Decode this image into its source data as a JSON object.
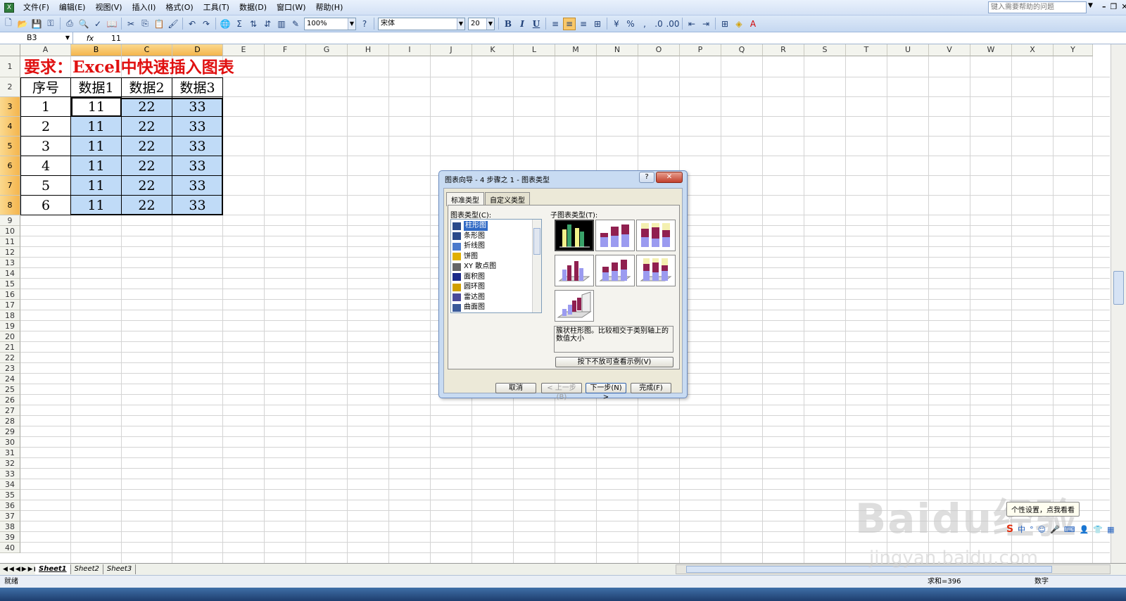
{
  "menu": {
    "items": [
      "文件(F)",
      "编辑(E)",
      "视图(V)",
      "插入(I)",
      "格式(O)",
      "工具(T)",
      "数据(D)",
      "窗口(W)",
      "帮助(H)"
    ],
    "help_placeholder": "键入需要帮助的问题"
  },
  "toolbar": {
    "zoom": "100%",
    "font": "宋体",
    "size": "20",
    "bold": "B",
    "italic": "I",
    "underline": "U"
  },
  "formula_bar": {
    "name_box": "B3",
    "fx": "fx",
    "value": "11"
  },
  "sheet": {
    "columns": [
      "A",
      "B",
      "C",
      "D",
      "E",
      "F",
      "G",
      "H",
      "I",
      "J",
      "K",
      "L",
      "M",
      "N",
      "O",
      "P",
      "Q",
      "R",
      "S",
      "T",
      "U",
      "V",
      "W",
      "X",
      "Y"
    ],
    "selected_columns": [
      "B",
      "C",
      "D"
    ],
    "rows": [
      "1",
      "2",
      "3",
      "4",
      "5",
      "6",
      "7",
      "8",
      "9",
      "10",
      "11",
      "12",
      "13",
      "14",
      "15",
      "16",
      "17",
      "18",
      "19",
      "20",
      "21",
      "22",
      "23",
      "24",
      "25",
      "26",
      "27",
      "28",
      "29",
      "30",
      "31",
      "32",
      "33",
      "34",
      "35",
      "36",
      "37",
      "38",
      "39",
      "40"
    ],
    "selected_rows": [
      "3",
      "4",
      "5",
      "6",
      "7",
      "8"
    ],
    "title": "要求：Excel中快速插入图表",
    "headers": [
      "序号",
      "数据1",
      "数据2",
      "数据3"
    ],
    "data": [
      [
        "1",
        "11",
        "22",
        "33"
      ],
      [
        "2",
        "11",
        "22",
        "33"
      ],
      [
        "3",
        "11",
        "22",
        "33"
      ],
      [
        "4",
        "11",
        "22",
        "33"
      ],
      [
        "5",
        "11",
        "22",
        "33"
      ],
      [
        "6",
        "11",
        "22",
        "33"
      ]
    ]
  },
  "sheet_tabs": [
    "Sheet1",
    "Sheet2",
    "Sheet3"
  ],
  "status": {
    "ready": "就绪",
    "sum": "求和=396",
    "mode": "数字"
  },
  "dialog": {
    "title": "图表向导 - 4 步骤之 1 - 图表类型",
    "help": "?",
    "close": "✕",
    "tabs": [
      "标准类型",
      "自定义类型"
    ],
    "chart_type_label": "图表类型(C):",
    "sub_type_label": "子图表类型(T):",
    "chart_types": [
      "柱形图",
      "条形图",
      "折线图",
      "饼图",
      "XY 散点图",
      "面积图",
      "圆环图",
      "雷达图",
      "曲面图"
    ],
    "description": "簇状柱形图。比较相交于类别轴上的数值大小",
    "press_button": "按下不放可查看示例(V)",
    "buttons": {
      "cancel": "取消",
      "back": "< 上一步(B)",
      "next": "下一步(N) >",
      "finish": "完成(F)"
    }
  },
  "overlay": {
    "tooltip": "个性设置，点我看看",
    "watermark": "Baidu经验",
    "watermark_url": "jingyan.baidu.com",
    "ime_lang": "中"
  }
}
